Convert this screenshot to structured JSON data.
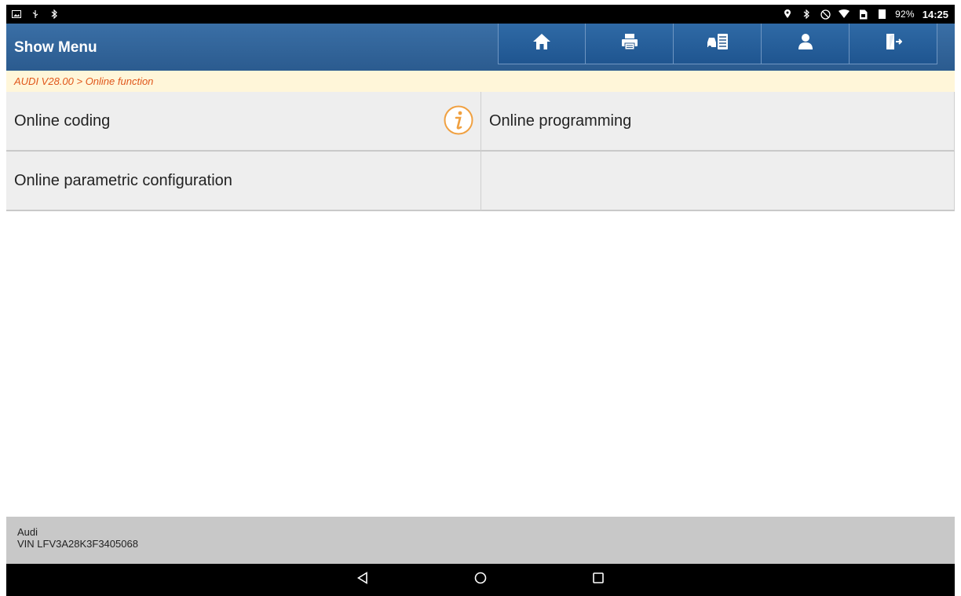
{
  "status_bar": {
    "left_icons": [
      "screenshot-icon",
      "usb-icon",
      "bluetooth-icon"
    ],
    "right_icons": [
      "location-icon",
      "bluetooth-icon",
      "do-not-disturb-icon",
      "wifi-icon",
      "sim-icon",
      "signal-icon"
    ],
    "battery": "92%",
    "time": "14:25"
  },
  "header": {
    "title": "Show Menu",
    "toolbar": [
      "home-icon",
      "print-icon",
      "vehicle-report-icon",
      "user-icon",
      "exit-icon"
    ]
  },
  "breadcrumb": "AUDI V28.00 > Online function",
  "menu": {
    "items": [
      {
        "label": "Online coding",
        "has_info": true
      },
      {
        "label": "Online programming"
      },
      {
        "label": "Online parametric configuration"
      },
      {
        "label": ""
      }
    ]
  },
  "footer": {
    "make": "Audi",
    "vin": "VIN LFV3A28K3F3405068"
  },
  "colors": {
    "header": "#2b5b8f",
    "breadcrumb_text": "#e0561a",
    "breadcrumb_bg": "#fff6d9",
    "info_icon": "#f0a040"
  }
}
